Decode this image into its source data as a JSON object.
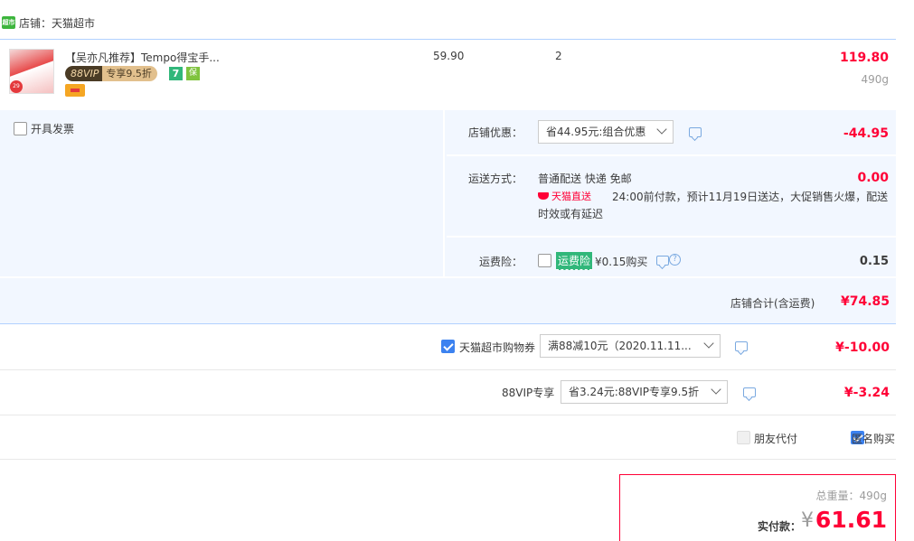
{
  "store": {
    "logo_text": "超市",
    "label": "店铺：天猫超市"
  },
  "product": {
    "title": "【吴亦凡推荐】Tempo得宝手...",
    "thumb_badge": "29",
    "vip_tag_left": "88VIP",
    "vip_tag_right": "专享9.5折",
    "service_seven": "7",
    "service_guard": "保",
    "unit_price": "59.90",
    "quantity": "2",
    "line_total": "119.80",
    "weight": "490g"
  },
  "invoice": {
    "label": "开具发票",
    "checked": false
  },
  "store_discount": {
    "label": "店铺优惠：",
    "selected": "省44.95元:组合优惠",
    "amount": "-44.95"
  },
  "shipping": {
    "label": "运送方式：",
    "method": "普通配送 快递 免邮",
    "amount": "0.00",
    "badge": "天猫直送",
    "delivery_line1": "24:00前付款，预计11月19日送达，大促销售火爆，配送",
    "delivery_line2": "时效或有延迟"
  },
  "insurance": {
    "label": "运费险：",
    "tag": "运费险",
    "price": "¥0.15购买",
    "question": "?",
    "amount": "0.15"
  },
  "store_total": {
    "label": "店铺合计(含运费)",
    "amount": "¥74.85"
  },
  "coupon": {
    "label": "天猫超市购物券",
    "selected": "满88减10元（2020.11.11...",
    "amount": "¥-10.00",
    "checked": true
  },
  "vip_discount": {
    "label": "88VIP专享",
    "selected": "省3.24元:88VIP专享9.5折",
    "amount": "¥-3.24"
  },
  "options": {
    "friend_pay": "朋友代付",
    "anonymous": "匿名购买"
  },
  "payment": {
    "weight": "总重量：490g",
    "label": "实付款：",
    "currency": "¥",
    "amount": "61.61"
  },
  "colors": {
    "accent_red": "#ff0036",
    "panel_blue": "#f2f7ff",
    "divider_blue": "#b2d1ff",
    "checkbox_blue": "#3c82f0",
    "green": "#31b77a"
  }
}
